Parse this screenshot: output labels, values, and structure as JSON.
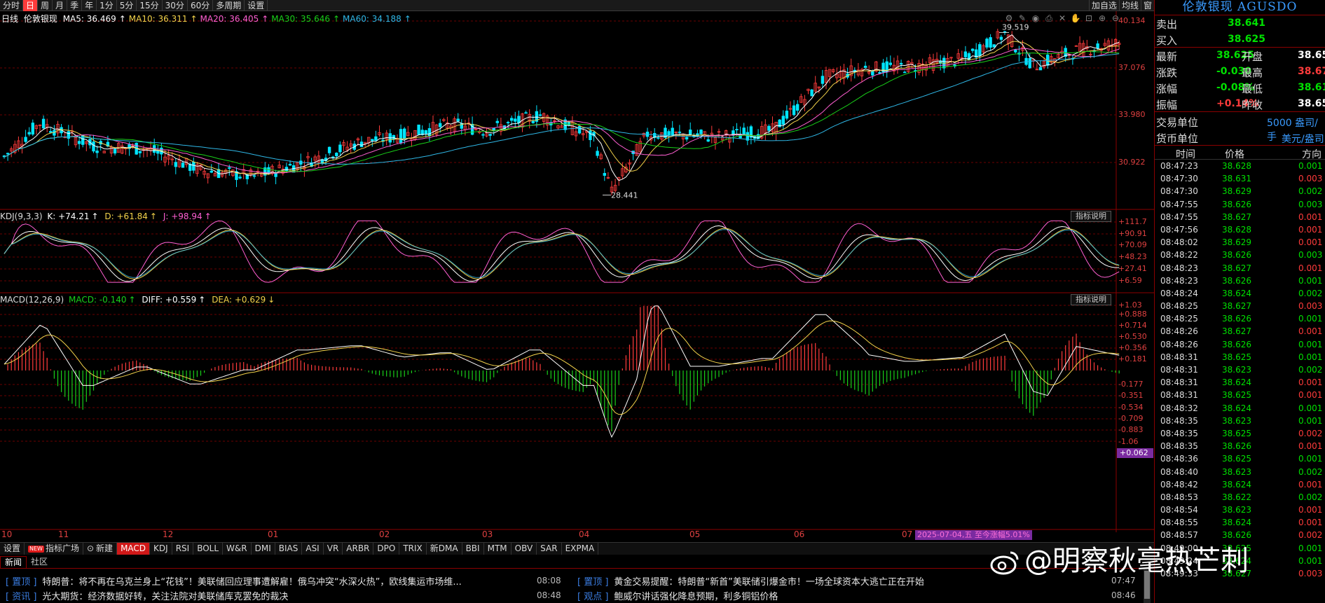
{
  "topbar": {
    "period_tabs": [
      {
        "label": "分时",
        "active": false
      },
      {
        "label": "日",
        "active": true
      },
      {
        "label": "周",
        "active": false
      },
      {
        "label": "月",
        "active": false
      },
      {
        "label": "季",
        "active": false
      },
      {
        "label": "年",
        "active": false
      },
      {
        "label": "1分",
        "active": false
      },
      {
        "label": "5分",
        "active": false
      },
      {
        "label": "15分",
        "active": false
      },
      {
        "label": "30分",
        "active": false
      },
      {
        "label": "60分",
        "active": false
      },
      {
        "label": "多周期",
        "active": false
      },
      {
        "label": "设置",
        "active": false
      }
    ],
    "right_buttons": [
      "加自选",
      "均线",
      "窗"
    ]
  },
  "main_chart": {
    "period": "日线",
    "name": "伦敦银现",
    "ma": [
      {
        "label": "MA5: 36.469",
        "color": "#ffffff"
      },
      {
        "label": "MA10: 36.311",
        "color": "#f2d24a"
      },
      {
        "label": "MA20: 36.405",
        "color": "#ff5fd2"
      },
      {
        "label": "MA30: 35.646",
        "color": "#19d019"
      },
      {
        "label": "MA60: 34.188",
        "color": "#2fb7e6"
      }
    ],
    "y_labels": [
      "40.134",
      "37.076",
      "33.980",
      "30.922"
    ],
    "high_label": "39.519",
    "low_label": "28.441",
    "tools": [
      "gear-icon",
      "pen-icon",
      "eye-icon",
      "printer-icon",
      "trash-icon",
      "hand-icon",
      "lock-icon",
      "zoom-in-icon",
      "zoom-out-icon"
    ],
    "colors": {
      "up": "#ff3b3b",
      "down": "#00e5ff",
      "bg": "#000000",
      "grid": "#6b0000"
    }
  },
  "kdj": {
    "title": "KDJ(9,3,3)",
    "k": "K: +74.21",
    "d": "D: +61.84",
    "j": "J: +98.94",
    "help": "指标说明",
    "y_labels": [
      "+111.7",
      "+90.91",
      "+70.09",
      "+48.23",
      "+27.41",
      "+6.59"
    ]
  },
  "macd": {
    "title": "MACD(12,26,9)",
    "macd": "MACD: -0.140",
    "diff": "DIFF: +0.559",
    "dea": "DEA: +0.629",
    "help": "指标说明",
    "y_labels": [
      "+1.03",
      "+0.888",
      "+0.714",
      "+0.530",
      "+0.356",
      "+0.181",
      "-0.177",
      "-0.351",
      "-0.534",
      "-0.709",
      "-0.883",
      "-1.06"
    ],
    "current": "+0.062"
  },
  "months": [
    "10",
    "11",
    "12",
    "01",
    "02",
    "03",
    "04",
    "05",
    "06",
    "07"
  ],
  "date_tag": "2025-07-04,五 至今涨幅5.01%",
  "indicator_tabs": [
    {
      "label": "设置",
      "active": false,
      "new": false
    },
    {
      "label": "指标广场",
      "active": false,
      "new": true
    },
    {
      "label": "新建",
      "active": false,
      "new": false
    },
    {
      "label": "MACD",
      "active": true,
      "new": false
    },
    {
      "label": "KDJ",
      "active": false,
      "new": false
    },
    {
      "label": "RSI",
      "active": false,
      "new": false
    },
    {
      "label": "BOLL",
      "active": false,
      "new": false
    },
    {
      "label": "W&R",
      "active": false,
      "new": false
    },
    {
      "label": "DMI",
      "active": false,
      "new": false
    },
    {
      "label": "BIAS",
      "active": false,
      "new": false
    },
    {
      "label": "ASI",
      "active": false,
      "new": false
    },
    {
      "label": "VR",
      "active": false,
      "new": false
    },
    {
      "label": "ARBR",
      "active": false,
      "new": false
    },
    {
      "label": "DPO",
      "active": false,
      "new": false
    },
    {
      "label": "TRIX",
      "active": false,
      "new": false
    },
    {
      "label": "新DMA",
      "active": false,
      "new": false
    },
    {
      "label": "BBI",
      "active": false,
      "new": false
    },
    {
      "label": "MTM",
      "active": false,
      "new": false
    },
    {
      "label": "OBV",
      "active": false,
      "new": false
    },
    {
      "label": "SAR",
      "active": false,
      "new": false
    },
    {
      "label": "EXPMA",
      "active": false,
      "new": false
    }
  ],
  "news_tabs": [
    "新闻",
    "社区"
  ],
  "news": [
    {
      "tag": "[ 置顶 ]",
      "text": "特朗普：将不再在乌克兰身上“花钱”！美联储回应理事遭解雇！俄乌冲突“水深火热”，欧线集运市场维...",
      "time": "08:08"
    },
    {
      "tag": "[ 置顶 ]",
      "text": "黄金交易提醒：特朗普“新首”美联储引爆金市！一场全球资本大逃亡正在开始",
      "time": "07:47"
    },
    {
      "tag": "[ 资讯 ]",
      "text": "光大期货：经济数据好转，关注法院对美联储库克罢免的裁决",
      "time": "08:48"
    },
    {
      "tag": "[ 观点 ]",
      "text": "鲍威尔讲话强化降息预期，利多铜铝价格",
      "time": "08:46"
    }
  ],
  "right_panel": {
    "title": "伦敦银现 AGUSDO",
    "sell": {
      "label": "卖出",
      "value": "38.641"
    },
    "buy": {
      "label": "买入",
      "value": "38.625"
    },
    "rows": [
      {
        "l1": "最新",
        "v1": "38.625",
        "c1": "#00e000",
        "l2": "开盘",
        "v2": "38.65",
        "c2": "#ffffff"
      },
      {
        "l1": "涨跌",
        "v1": "-0.030",
        "c1": "#00e000",
        "l2": "最高",
        "v2": "38.67",
        "c2": "#ff3b3b"
      },
      {
        "l1": "涨幅",
        "v1": "-0.08%",
        "c1": "#00e000",
        "l2": "最低",
        "v2": "38.61",
        "c2": "#00e000"
      },
      {
        "l1": "振幅",
        "v1": "+0.14%",
        "c1": "#ff3b3b",
        "l2": "昨收",
        "v2": "38.65",
        "c2": "#ffffff"
      }
    ],
    "unit": {
      "label": "交易单位",
      "value": "5000 盎司/手"
    },
    "currency": {
      "label": "货币单位",
      "value": "美元/盎司"
    },
    "tick_header": [
      "时间",
      "价格",
      "方向"
    ],
    "ticks": [
      {
        "t": "08:47:23",
        "p": "38.628",
        "d": "0.001",
        "up": false
      },
      {
        "t": "08:47:30",
        "p": "38.631",
        "d": "0.003",
        "up": true
      },
      {
        "t": "08:47:30",
        "p": "38.629",
        "d": "0.002",
        "up": false
      },
      {
        "t": "08:47:55",
        "p": "38.626",
        "d": "0.003",
        "up": false
      },
      {
        "t": "08:47:55",
        "p": "38.627",
        "d": "0.001",
        "up": true
      },
      {
        "t": "08:47:56",
        "p": "38.628",
        "d": "0.001",
        "up": true
      },
      {
        "t": "08:48:02",
        "p": "38.629",
        "d": "0.001",
        "up": true
      },
      {
        "t": "08:48:22",
        "p": "38.626",
        "d": "0.003",
        "up": false
      },
      {
        "t": "08:48:23",
        "p": "38.627",
        "d": "0.001",
        "up": true
      },
      {
        "t": "08:48:23",
        "p": "38.626",
        "d": "0.001",
        "up": false
      },
      {
        "t": "08:48:24",
        "p": "38.624",
        "d": "0.002",
        "up": false
      },
      {
        "t": "08:48:25",
        "p": "38.627",
        "d": "0.003",
        "up": true
      },
      {
        "t": "08:48:25",
        "p": "38.626",
        "d": "0.001",
        "up": false
      },
      {
        "t": "08:48:26",
        "p": "38.627",
        "d": "0.001",
        "up": true
      },
      {
        "t": "08:48:26",
        "p": "38.626",
        "d": "0.001",
        "up": false
      },
      {
        "t": "08:48:31",
        "p": "38.625",
        "d": "0.001",
        "up": false
      },
      {
        "t": "08:48:31",
        "p": "38.623",
        "d": "0.002",
        "up": false
      },
      {
        "t": "08:48:31",
        "p": "38.624",
        "d": "0.001",
        "up": true
      },
      {
        "t": "08:48:31",
        "p": "38.625",
        "d": "0.001",
        "up": true
      },
      {
        "t": "08:48:32",
        "p": "38.624",
        "d": "0.001",
        "up": false
      },
      {
        "t": "08:48:35",
        "p": "38.623",
        "d": "0.001",
        "up": false
      },
      {
        "t": "08:48:35",
        "p": "38.625",
        "d": "0.002",
        "up": true
      },
      {
        "t": "08:48:35",
        "p": "38.626",
        "d": "0.001",
        "up": true
      },
      {
        "t": "08:48:36",
        "p": "38.625",
        "d": "0.001",
        "up": false
      },
      {
        "t": "08:48:40",
        "p": "38.623",
        "d": "0.002",
        "up": false
      },
      {
        "t": "08:48:42",
        "p": "38.624",
        "d": "0.001",
        "up": true
      },
      {
        "t": "08:48:53",
        "p": "38.622",
        "d": "0.002",
        "up": false
      },
      {
        "t": "08:48:54",
        "p": "38.623",
        "d": "0.001",
        "up": true
      },
      {
        "t": "08:48:55",
        "p": "38.624",
        "d": "0.001",
        "up": true
      },
      {
        "t": "08:48:57",
        "p": "38.626",
        "d": "0.002",
        "up": true
      },
      {
        "t": "08:49:00",
        "p": "38.625",
        "d": "0.001",
        "up": false
      },
      {
        "t": "08:49:24",
        "p": "38.624",
        "d": "0.001",
        "up": false
      },
      {
        "t": "08:49:33",
        "p": "38.627",
        "d": "0.003",
        "up": true
      }
    ]
  },
  "watermark": "@明察秋毫热芒刺"
}
